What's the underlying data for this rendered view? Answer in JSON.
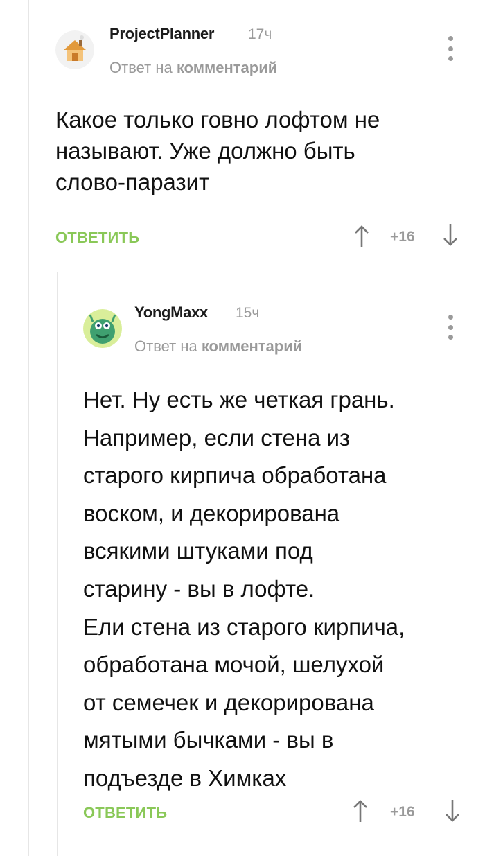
{
  "comments": [
    {
      "author": "ProjectPlanner",
      "time": "17ч",
      "reply_prefix": "Ответ на",
      "reply_target": "комментарий",
      "text_lines": [
        "Какое только говно лофтом не",
        "называют. Уже должно быть",
        "слово-паразит"
      ],
      "reply_label": "ОТВЕТИТЬ",
      "score": "+16"
    },
    {
      "author": "YongMaxx",
      "time": "15ч",
      "reply_prefix": "Ответ на",
      "reply_target": "комментарий",
      "text_lines": [
        "Нет. Ну есть же четкая грань.",
        "Например, если стена из",
        "старого кирпича обработана",
        "воском, и декорирована",
        "всякими штуками под",
        "старину - вы в лофте.",
        "Ели стена из старого кирпича,",
        "обработана мочой, шелухой",
        "от семечек и декорирована",
        "мятыми бычками - вы в",
        "подъезде в Химках"
      ],
      "reply_label": "ОТВЕТИТЬ",
      "score": "+16"
    }
  ],
  "colors": {
    "accent_green": "#8ac858",
    "muted_gray": "#9a9a9a",
    "thread_line": "#e6e6e6"
  }
}
